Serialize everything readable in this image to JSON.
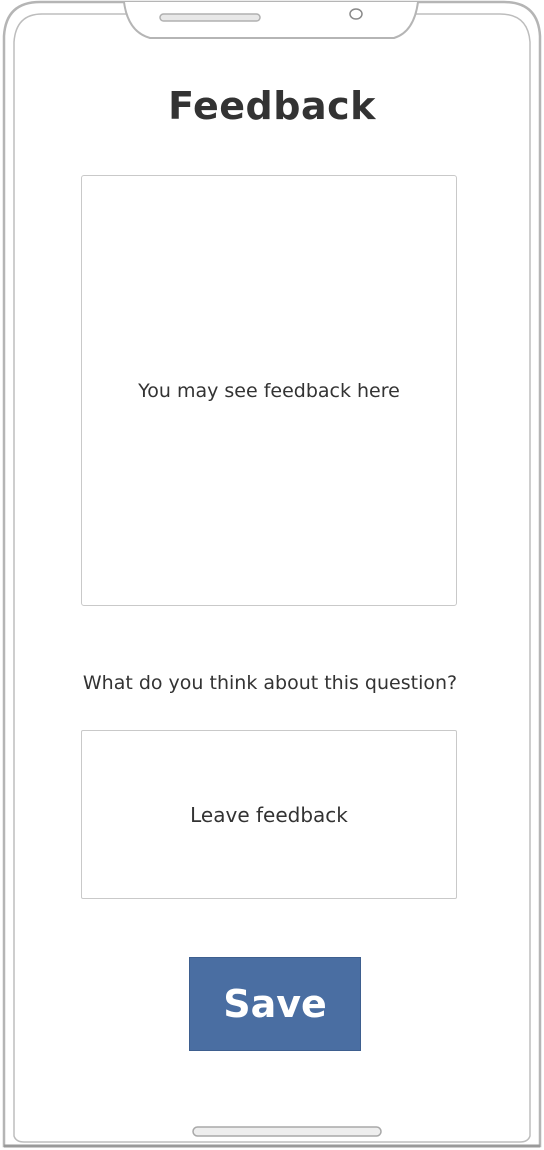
{
  "header": {
    "title": "Feedback"
  },
  "feedback_display": {
    "text": "You may see feedback here"
  },
  "question": {
    "label": "What do you think about this question?"
  },
  "feedback_input": {
    "placeholder": "Leave feedback"
  },
  "actions": {
    "save_label": "Save"
  },
  "colors": {
    "accent": "#4a6ea2",
    "text": "#333333",
    "border": "#c9c9c9"
  },
  "icons": {
    "notch_speaker": "speaker-slot-icon",
    "notch_camera": "camera-icon",
    "home_indicator": "home-indicator-bar"
  }
}
